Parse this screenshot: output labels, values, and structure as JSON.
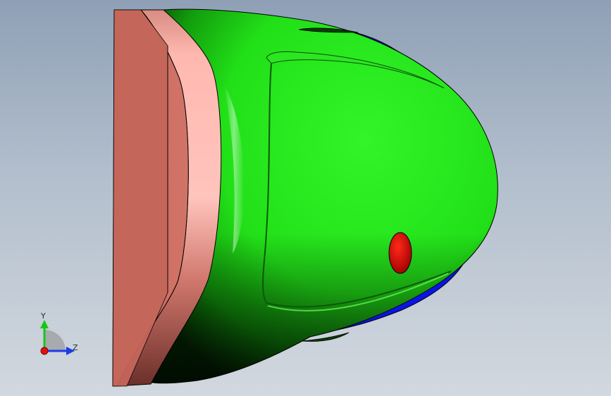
{
  "viewport": {
    "background_top": "#8fa0b6",
    "background_bottom": "#d2d8df"
  },
  "model": {
    "parts": [
      {
        "name": "mounting-plate",
        "color": "#c8685c"
      },
      {
        "name": "trim-ring",
        "color": "#ffb5ad"
      },
      {
        "name": "shell",
        "color": "#26ee1a"
      },
      {
        "name": "lens",
        "color": "#0a14e6"
      },
      {
        "name": "indicator",
        "color": "#d40000"
      }
    ]
  },
  "triad": {
    "y_label": "Y",
    "z_label": "Z",
    "y_color": "#14c814",
    "z_color": "#1a3be8",
    "x_color": "#e01010",
    "icons": [
      "y-axis-arrow-icon",
      "z-axis-arrow-icon",
      "x-axis-dot-icon"
    ]
  }
}
